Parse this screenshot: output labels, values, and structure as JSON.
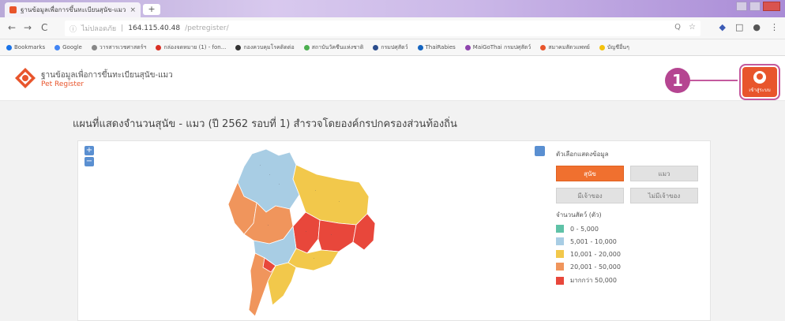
{
  "browser": {
    "tab_title": "ฐานข้อมูลเพื่อการขึ้นทะเบียนสุนัข-แมว",
    "tab_close": "×",
    "newtab": "+",
    "back": "←",
    "forward": "→",
    "reload": "C",
    "security": "ไม่ปลอดภัย",
    "url_host": "164.115.40.48",
    "url_path": "/petregister/",
    "zoom_icon": "Q",
    "star": "☆",
    "menu": "⋮"
  },
  "bookmarks": [
    {
      "label": "Bookmarks",
      "color": "#1a73e8"
    },
    {
      "label": "Google",
      "color": "#4285f4"
    },
    {
      "label": "วารสารเวชศาสตร์ฯ",
      "color": "#888888"
    },
    {
      "label": "กล่องจดหมาย (1) - fon...",
      "color": "#d93025"
    },
    {
      "label": "กองควบคุมโรคติดต่อ",
      "color": "#333333"
    },
    {
      "label": "สถาบันวัคซีนแห่งชาติ",
      "color": "#4caf50"
    },
    {
      "label": "กรมปศุสัตว์",
      "color": "#2b4d8c"
    },
    {
      "label": "ThaiRabies",
      "color": "#1565c0"
    },
    {
      "label": "MaiGoThai กรมปศุสัตว์",
      "color": "#8e44ad"
    },
    {
      "label": "สมาคมสัตวแพทย์",
      "color": "#e8552c"
    },
    {
      "label": "บัญชีอื่นๆ",
      "color": "#f4c20d"
    }
  ],
  "header": {
    "brand_th": "ฐานข้อมูลเพื่อการขึ้นทะเบียนสุนัข-แมว",
    "brand_en": "Pet Register",
    "login_label": "เข้าสู่ระบบ",
    "callout": "1"
  },
  "main": {
    "title": "แผนที่แสดงจำนวนสุนัข - แมว (ปี 2562 รอบที่ 1) สำรวจโดยองค์กรปกครองส่วนท้องถิ่น",
    "zoom_in": "+",
    "zoom_out": "−",
    "legend_title": "ตัวเลือกแสดงข้อมูล",
    "btn_dog": "สุนัข",
    "btn_cat": "แมว",
    "btn_owner": "มีเจ้าของ",
    "btn_no_owner": "ไม่มีเจ้าของ",
    "count_title": "จำนวนสัตว์ (ตัว)",
    "ranges": [
      {
        "label": "0 - 5,000",
        "color": "#5fc2a7"
      },
      {
        "label": "5,001 - 10,000",
        "color": "#a8cde4"
      },
      {
        "label": "10,001 - 20,000",
        "color": "#f2c84b"
      },
      {
        "label": "20,001 - 50,000",
        "color": "#f0955c"
      },
      {
        "label": "มากกว่า 50,000",
        "color": "#e8473b"
      }
    ]
  }
}
